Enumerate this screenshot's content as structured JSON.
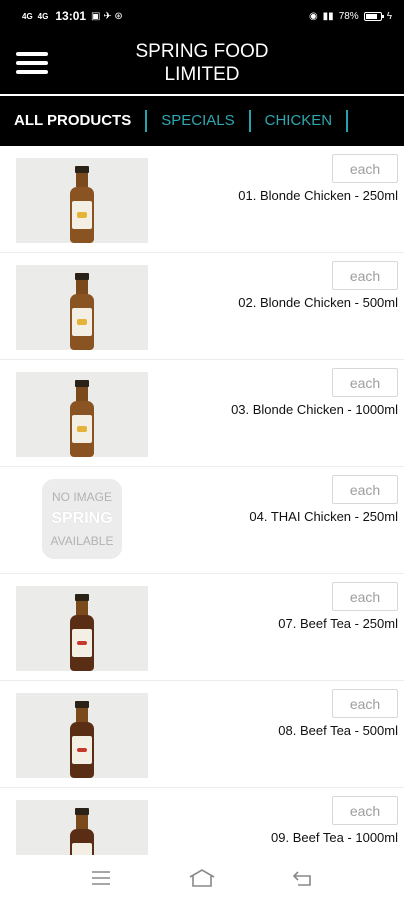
{
  "status_bar": {
    "signal_left": "4G",
    "signal_right": "4G",
    "time": "13:01",
    "battery": "78%"
  },
  "header": {
    "title_line1": "SPRING FOOD",
    "title_line2": "LIMITED"
  },
  "tabs": [
    "ALL PRODUCTS",
    "SPECIALS",
    "CHICKEN"
  ],
  "colors": {
    "tab_active": "#ffffff",
    "tab_inactive": "#2fa7b1",
    "header_bg": "#000000"
  },
  "products": [
    {
      "name": "01. Blonde Chicken - 250ml",
      "unit": "each",
      "image": "bottle-blonde"
    },
    {
      "name": "02. Blonde Chicken - 500ml",
      "unit": "each",
      "image": "bottle-blonde"
    },
    {
      "name": "03. Blonde Chicken - 1000ml",
      "unit": "each",
      "image": "bottle-blonde"
    },
    {
      "name": "04. THAI Chicken - 250ml",
      "unit": "each",
      "image": "no-image"
    },
    {
      "name": "07. Beef Tea - 250ml",
      "unit": "each",
      "image": "bottle-beef"
    },
    {
      "name": "08. Beef Tea - 500ml",
      "unit": "each",
      "image": "bottle-beef"
    },
    {
      "name": "09. Beef Tea - 1000ml",
      "unit": "each",
      "image": "bottle-beef"
    }
  ],
  "no_image": {
    "line1": "NO IMAGE",
    "brand": "SPRING",
    "line2": "AVAILABLE"
  },
  "bottom_nav": [
    "menu-icon",
    "home-icon",
    "back-icon"
  ]
}
